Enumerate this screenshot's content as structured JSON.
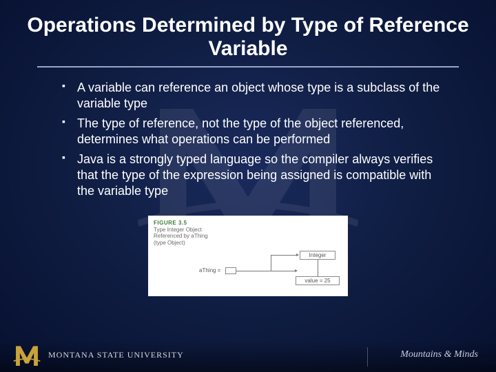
{
  "title": "Operations Determined by Type of Reference Variable",
  "bullets": [
    "A variable can reference an object whose type is a subclass of the variable type",
    "The type of reference, not the type of the object referenced, determines what operations can be performed",
    "Java is a strongly typed language so the compiler always verifies that the type of the expression being assigned is compatible with the variable type"
  ],
  "figure": {
    "label_num": "FIGURE 3.5",
    "caption_line1": "Type Integer Object",
    "caption_line2": "Referenced by aThing",
    "caption_line3": "(type Object)",
    "var_name": "aThing =",
    "class_box": "Integer",
    "value_box": "value = 25"
  },
  "footer": {
    "university": "MONTANA",
    "university_sub": "STATE UNIVERSITY",
    "tagline_a": "Mountains",
    "tagline_amp": "&",
    "tagline_b": "Minds"
  }
}
